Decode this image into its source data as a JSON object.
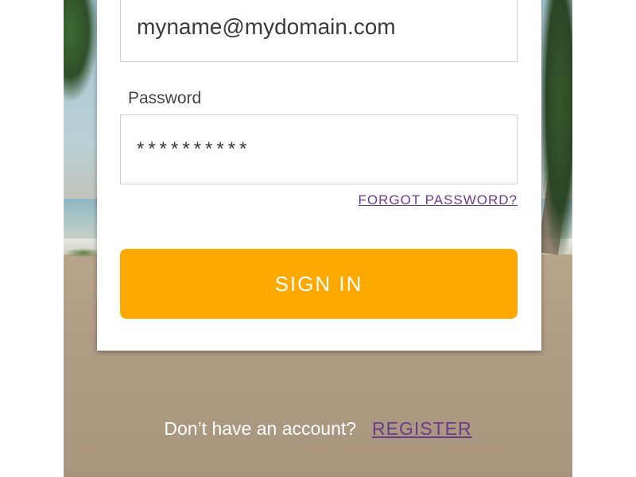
{
  "login": {
    "email_value": "myname@mydomain.com",
    "password_label": "Password",
    "password_value": "**********",
    "forgot_password_link": "FORGOT PASSWORD?",
    "sign_in_button": "SIGN IN"
  },
  "footer": {
    "no_account_text": "Don’t have an account?",
    "register_link": "REGISTER"
  },
  "colors": {
    "sign_in_button": "#ffa800",
    "link": "#6b3a8c"
  }
}
